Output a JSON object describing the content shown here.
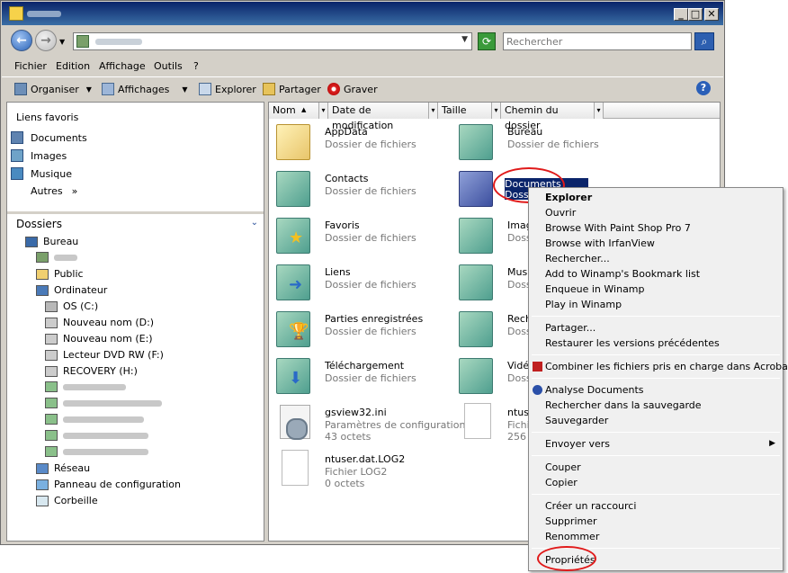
{
  "window": {
    "title": ""
  },
  "address": {
    "search_placeholder": "Rechercher"
  },
  "menubar": [
    "Fichier",
    "Edition",
    "Affichage",
    "Outils",
    "?"
  ],
  "toolbar": {
    "organize": "Organiser",
    "views": "Affichages",
    "explore": "Explorer",
    "share": "Partager",
    "burn": "Graver"
  },
  "favorites": {
    "title": "Liens favoris",
    "items": [
      "Documents",
      "Images",
      "Musique"
    ],
    "more": "Autres",
    "more_chevron": "»"
  },
  "tree": {
    "title": "Dossiers",
    "items": [
      "Bureau",
      "Public",
      "Ordinateur",
      "OS (C:)",
      "Nouveau nom (D:)",
      "Nouveau nom (E:)",
      "Lecteur DVD RW (F:)",
      "RECOVERY (H:)",
      "Réseau",
      "Panneau de configuration",
      "Corbeille"
    ]
  },
  "columns": [
    "Nom",
    "Date de modification",
    "Taille",
    "Chemin du dossier"
  ],
  "files": [
    {
      "name": "AppData",
      "type": "Dossier de fichiers",
      "size": ""
    },
    {
      "name": "Bureau",
      "type": "Dossier de fichiers",
      "size": ""
    },
    {
      "name": "Contacts",
      "type": "Dossier de fichiers",
      "size": ""
    },
    {
      "name": "Documents",
      "type": "Dossier de fichiers",
      "size": ""
    },
    {
      "name": "Favoris",
      "type": "Dossier de fichiers",
      "size": ""
    },
    {
      "name": "Images",
      "type": "Dossier de fichiers",
      "size": ""
    },
    {
      "name": "Liens",
      "type": "Dossier de fichiers",
      "size": ""
    },
    {
      "name": "Musique",
      "type": "Dossier de fichiers",
      "size": ""
    },
    {
      "name": "Parties enregistrées",
      "type": "Dossier de fichiers",
      "size": ""
    },
    {
      "name": "Recherches",
      "type": "Dossier de fichiers",
      "size": ""
    },
    {
      "name": "Téléchargement",
      "type": "Dossier de fichiers",
      "size": ""
    },
    {
      "name": "Vidéos",
      "type": "Dossier de fichiers",
      "size": ""
    },
    {
      "name": "gsview32.ini",
      "type": "Paramètres de configuration",
      "size": "43 octets"
    },
    {
      "name": "ntuser.dat",
      "type": "Fichier",
      "size": "256 Ko"
    },
    {
      "name": "ntuser.dat.LOG2",
      "type": "Fichier LOG2",
      "size": "0 octets"
    }
  ],
  "context_menu": {
    "group1": [
      "Explorer",
      "Ouvrir",
      "Browse With Paint Shop Pro 7",
      "Browse with IrfanView",
      "Rechercher...",
      "Add to Winamp's Bookmark list",
      "Enqueue in Winamp",
      "Play in Winamp"
    ],
    "group2": [
      "Partager...",
      "Restaurer les versions précédentes"
    ],
    "group3": [
      "Combiner les fichiers pris en charge dans Acrobat..."
    ],
    "group4": [
      "Analyse Documents",
      "Rechercher dans la sauvegarde",
      "Sauvegarder"
    ],
    "group5": [
      "Envoyer vers"
    ],
    "group6": [
      "Couper",
      "Copier"
    ],
    "group7": [
      "Créer un raccourci",
      "Supprimer",
      "Renommer"
    ],
    "group8": [
      "Propriétés"
    ],
    "submenu_arrow": "▶"
  },
  "colors": {
    "selection": "#0a246a",
    "highlight_circle": "#e01a1a"
  }
}
